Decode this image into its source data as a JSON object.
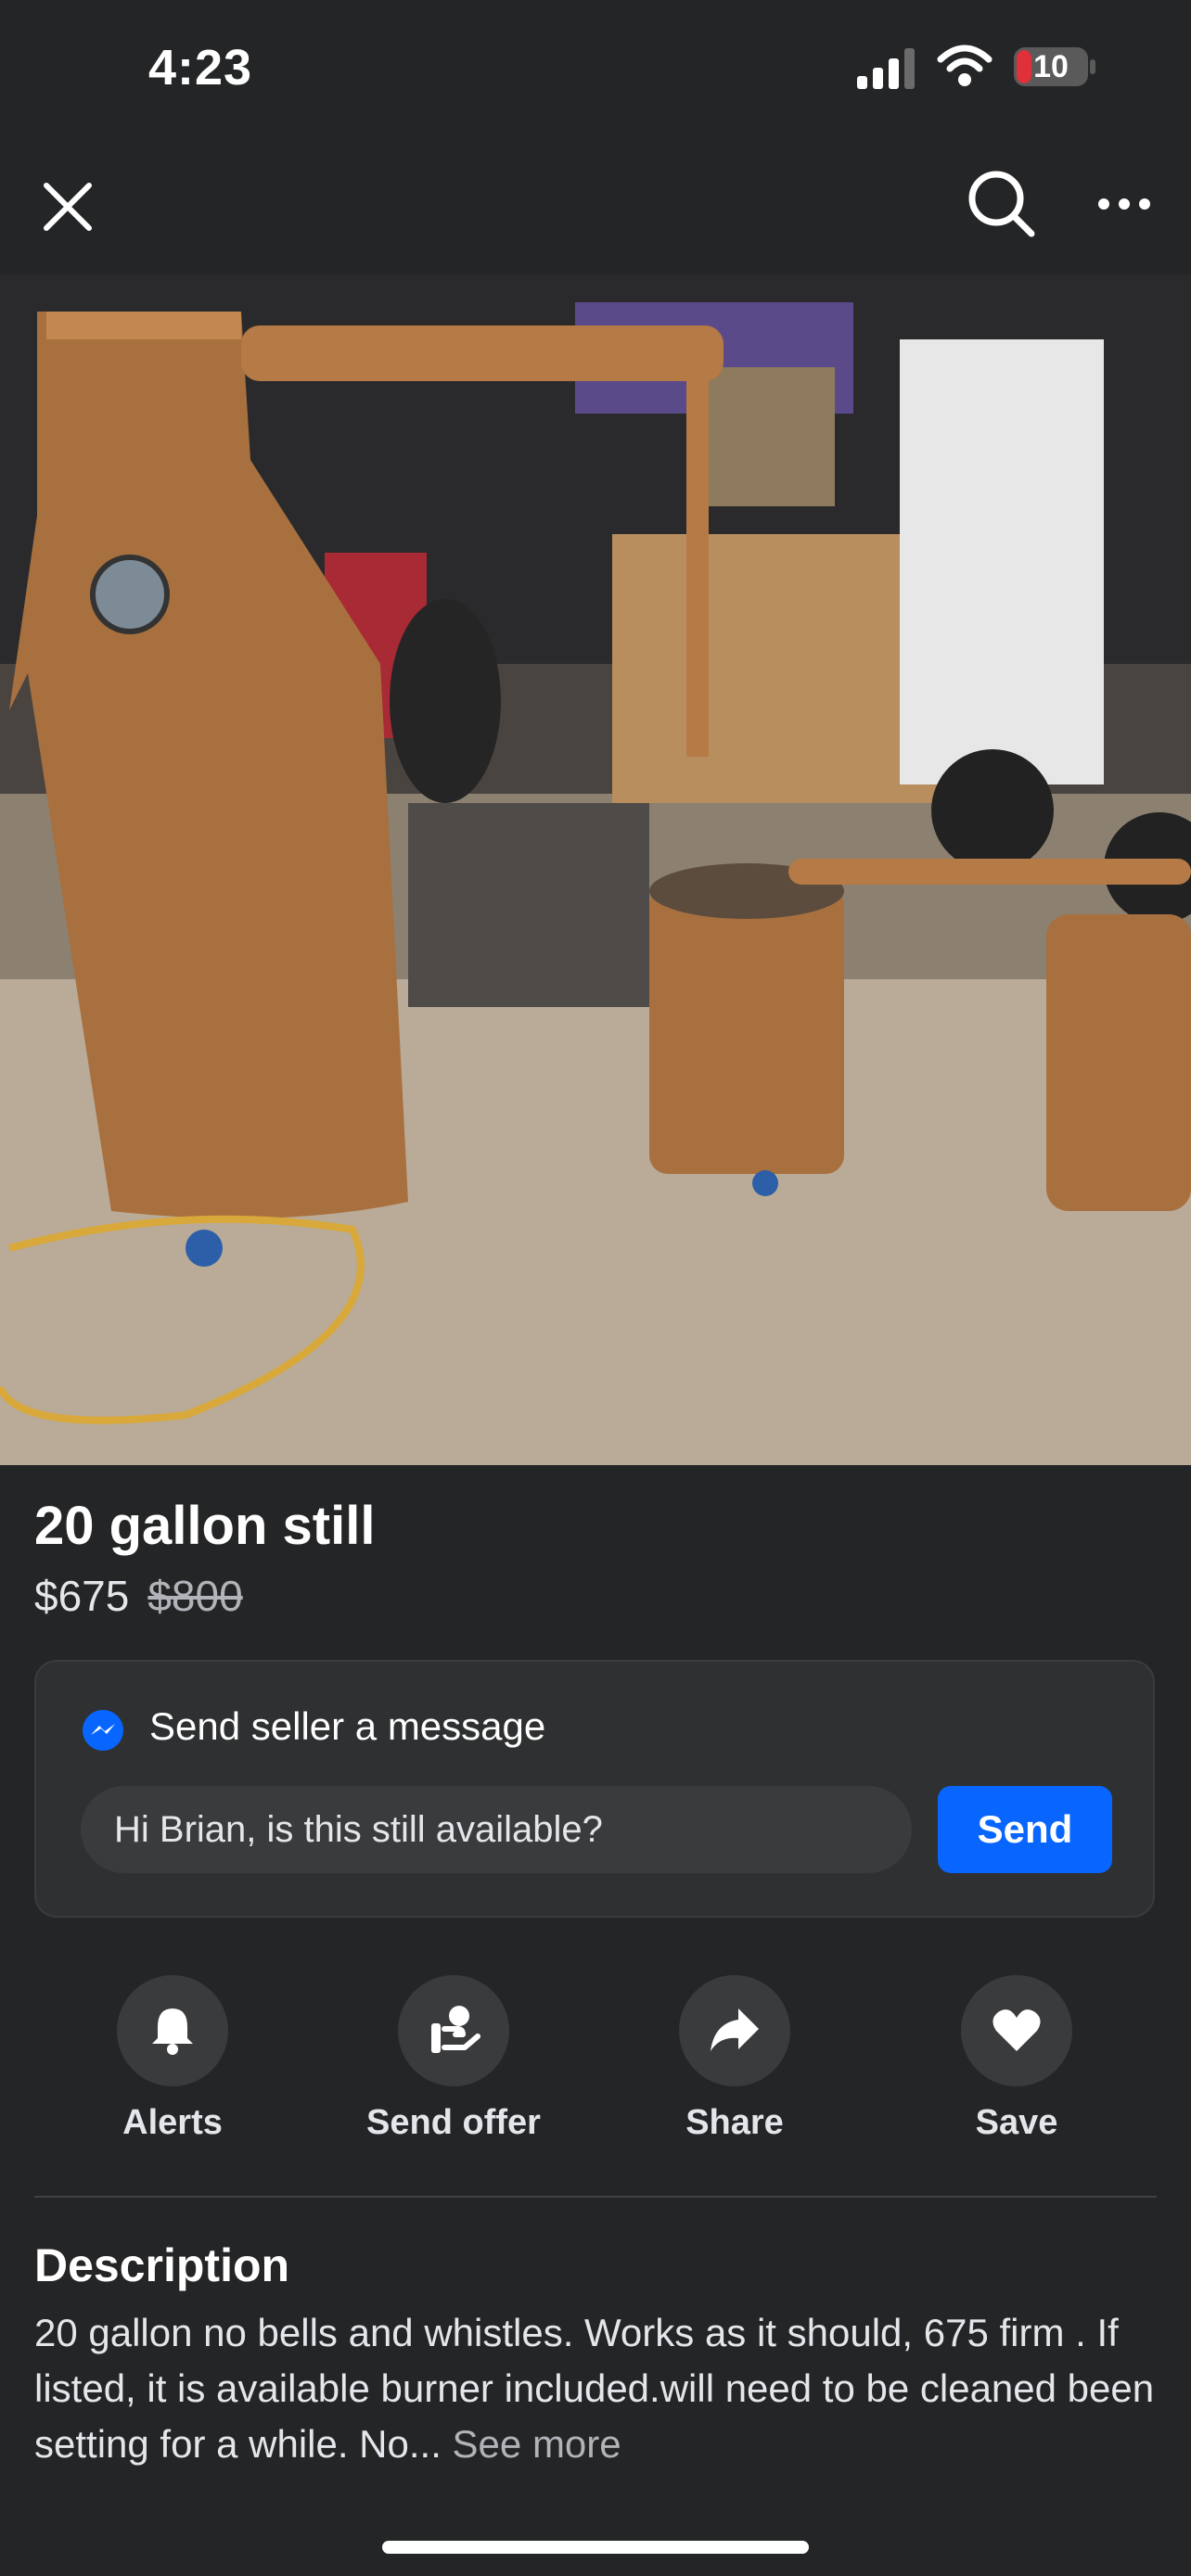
{
  "status_bar": {
    "time": "4:23",
    "battery": "10"
  },
  "icons": {
    "close": "close-icon",
    "search": "search-icon",
    "more": "more-icon",
    "messenger": "messenger-icon",
    "alerts": "bell-icon",
    "send_offer": "send-offer-icon",
    "share": "share-arrow-icon",
    "save": "heart-icon"
  },
  "listing": {
    "title": "20 gallon still",
    "price": "$675",
    "original_price": "$800"
  },
  "message": {
    "heading": "Send seller a message",
    "input_value": "Hi Brian, is this still available?",
    "send_label": "Send"
  },
  "actions": [
    {
      "label": "Alerts"
    },
    {
      "label": "Send offer"
    },
    {
      "label": "Share"
    },
    {
      "label": "Save"
    }
  ],
  "description": {
    "heading": "Description",
    "text": "20 gallon  no bells and whistles.  Works as  it should,  675 firm . If listed,  it is available burner included.will need to  be cleaned been setting for a while. No...",
    "see_more": "See more"
  },
  "colors": {
    "background": "#242526",
    "card": "#2f3031",
    "accent": "#0866ff",
    "battery_low": "#e0303a"
  }
}
